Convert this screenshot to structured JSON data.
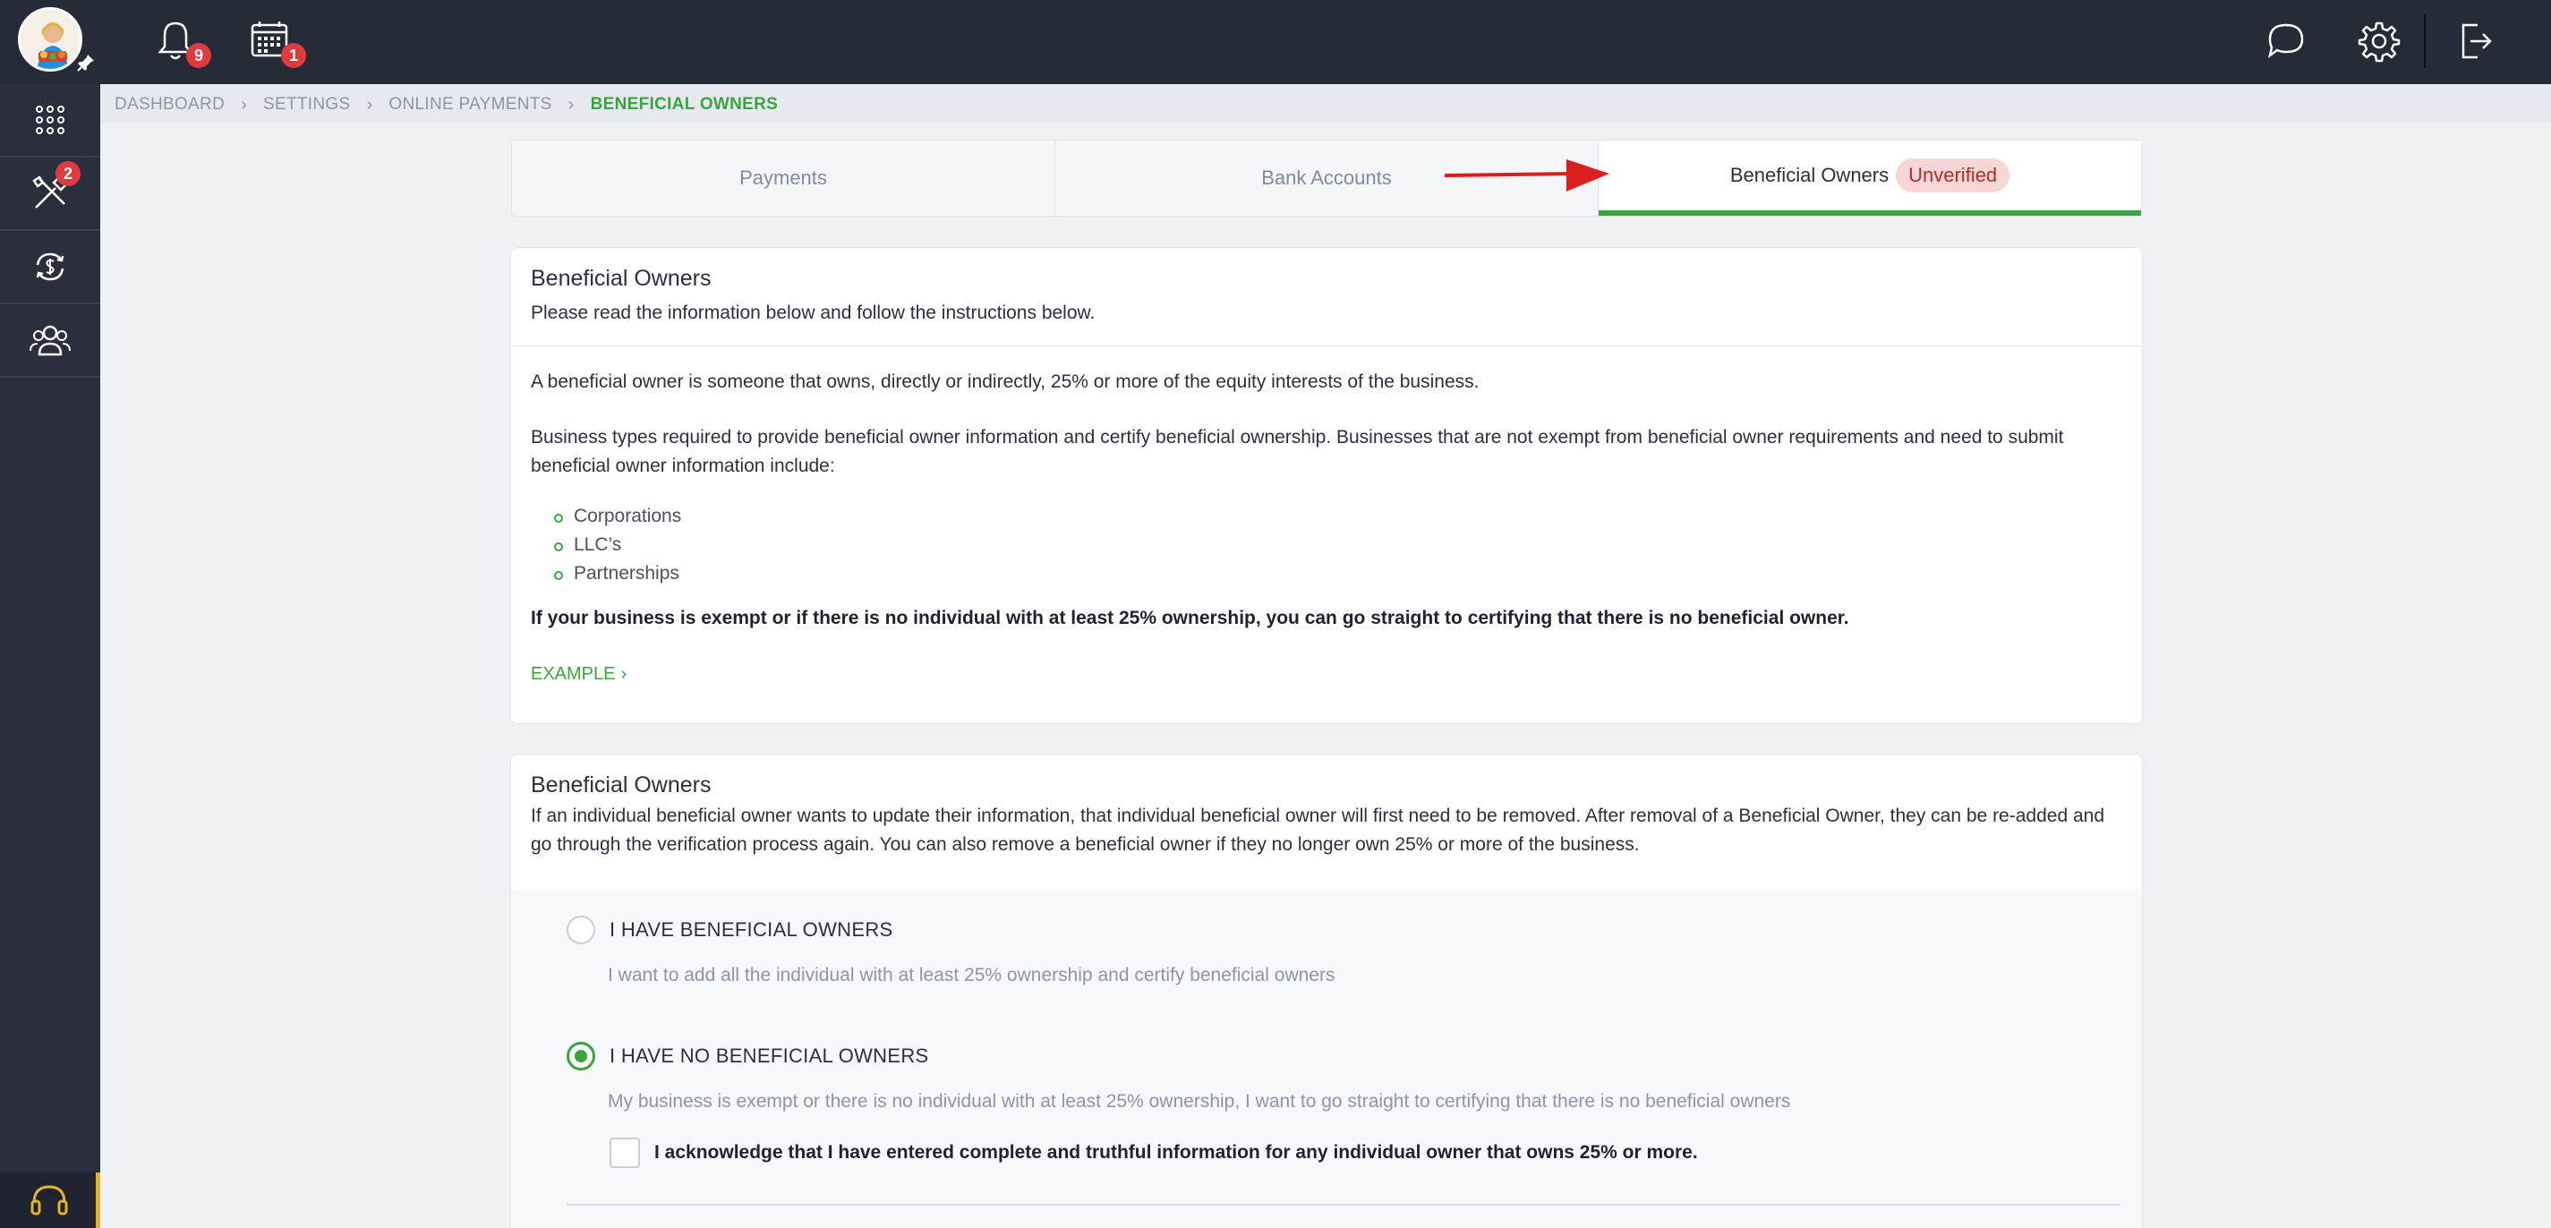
{
  "topbar": {
    "notifications_count": "9",
    "calendar_count": "1"
  },
  "sidebar": {
    "tools_badge": "2"
  },
  "breadcrumb": [
    "DASHBOARD",
    "SETTINGS",
    "ONLINE PAYMENTS",
    "BENEFICIAL OWNERS"
  ],
  "tabs": {
    "payments": "Payments",
    "bank_accounts": "Bank Accounts",
    "beneficial_owners": "Beneficial Owners",
    "status_pill": "Unverified"
  },
  "info_card": {
    "title": "Beneficial Owners",
    "subtitle": "Please read the information below and follow the instructions below.",
    "para1": "A beneficial owner is someone that owns, directly or indirectly, 25% or more of the equity interests of the business.",
    "para2": "Business types required to provide beneficial owner information and certify beneficial ownership. Businesses that are not exempt from beneficial owner requirements and need to submit beneficial owner information include:",
    "bullets": [
      "Corporations",
      "LLC’s",
      "Partnerships"
    ],
    "bold_note": "If your business is exempt or if there is no individual with at least 25% ownership, you can go straight to certifying that there is no beneficial owner.",
    "example_link": "EXAMPLE"
  },
  "owners_card": {
    "title": "Beneficial Owners",
    "subtitle": "If an individual beneficial owner wants to update their information, that individual beneficial owner will first need to be removed. After removal of a Beneficial Owner, they can be re-added and go through the verification process again. You can also remove a beneficial owner if they no longer own 25% or more of the business."
  },
  "options": {
    "have_owners_label": "I HAVE BENEFICIAL OWNERS",
    "have_owners_desc": "I want to add all the individual with at least 25% ownership and certify beneficial owners",
    "no_owners_label": "I HAVE NO BENEFICIAL OWNERS",
    "no_owners_desc": "My business is exempt or there is no individual with at least 25% ownership, I want to go straight to certifying that there is no beneficial owners",
    "acknowledge_label": "I acknowledge that I have entered complete and truthful information for any individual owner that owns 25% or more.",
    "selected": "no_owners"
  },
  "colors": {
    "accent_green": "#3aa53d",
    "badge_red": "#e03a3e",
    "topbar": "#262b38",
    "pill_bg": "#f6d6d6"
  }
}
